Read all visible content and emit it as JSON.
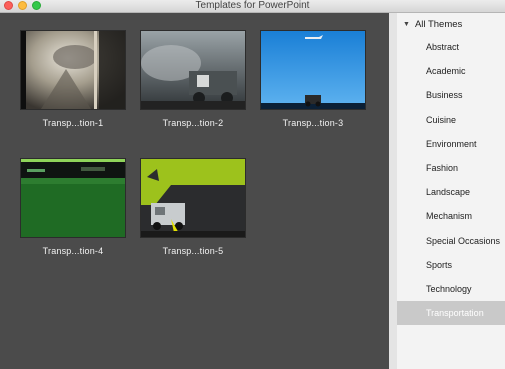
{
  "window": {
    "title": "Templates for PowerPoint"
  },
  "templates": [
    {
      "label": "Transp...tion-1"
    },
    {
      "label": "Transp...tion-2"
    },
    {
      "label": "Transp...tion-3"
    },
    {
      "label": "Transp...tion-4"
    },
    {
      "label": "Transp...tion-5"
    }
  ],
  "sidebar": {
    "header": "All Themes",
    "items": [
      {
        "label": "Abstract"
      },
      {
        "label": "Academic"
      },
      {
        "label": "Business"
      },
      {
        "label": "Cuisine"
      },
      {
        "label": "Environment"
      },
      {
        "label": "Fashion"
      },
      {
        "label": "Landscape"
      },
      {
        "label": "Mechanism"
      },
      {
        "label": "Special Occasions"
      },
      {
        "label": "Sports"
      },
      {
        "label": "Technology"
      },
      {
        "label": "Transportation"
      }
    ],
    "selected": "Transportation"
  }
}
